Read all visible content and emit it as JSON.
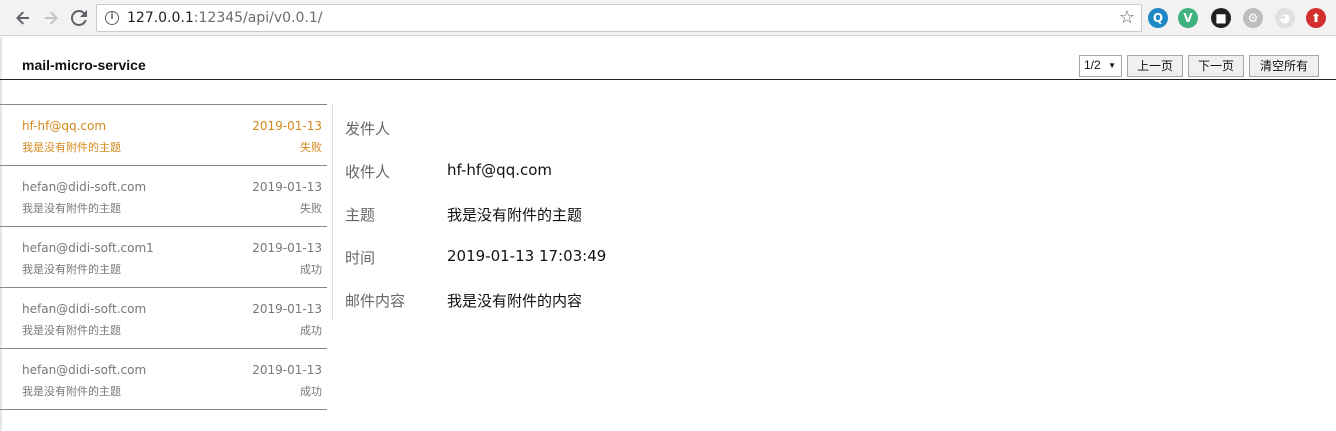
{
  "browser": {
    "url_host": "127.0.0.1",
    "url_rest": ":12345/api/v0.0.1/",
    "icons": [
      "back-icon",
      "forward-icon",
      "reload-icon",
      "info-icon",
      "star-icon"
    ],
    "extensions": [
      {
        "name": "extension-q-icon",
        "glyph": "Q",
        "color": "#1e88c7"
      },
      {
        "name": "extension-vue-icon",
        "glyph": "V",
        "color": "#3fb27f"
      },
      {
        "name": "extension-tampermonkey-icon",
        "glyph": "■",
        "color": "#222222"
      },
      {
        "name": "extension-gear-icon",
        "glyph": "⚙",
        "color": "#bdbdbd"
      },
      {
        "name": "extension-cat-icon",
        "glyph": "◕",
        "color": "#e0e0e0"
      },
      {
        "name": "extension-upload-icon",
        "glyph": "⬆",
        "color": "#d32f2f"
      }
    ]
  },
  "header": {
    "title": "mail-micro-service",
    "pager_value": "1/2",
    "prev_label": "上一页",
    "next_label": "下一页",
    "clear_label": "清空所有"
  },
  "mails": [
    {
      "sender": "hf-hf@qq.com",
      "date": "2019-01-13",
      "subject": "我是没有附件的主题",
      "status": "失败"
    },
    {
      "sender": "hefan@didi-soft.com",
      "date": "2019-01-13",
      "subject": "我是没有附件的主题",
      "status": "失败"
    },
    {
      "sender": "hefan@didi-soft.com1",
      "date": "2019-01-13",
      "subject": "我是没有附件的主题",
      "status": "成功"
    },
    {
      "sender": "hefan@didi-soft.com",
      "date": "2019-01-13",
      "subject": "我是没有附件的主题",
      "status": "成功"
    },
    {
      "sender": "hefan@didi-soft.com",
      "date": "2019-01-13",
      "subject": "我是没有附件的主题",
      "status": "成功"
    }
  ],
  "detail": {
    "from_label": "发件人",
    "from_value": "",
    "to_label": "收件人",
    "to_value": "hf-hf@qq.com",
    "subject_label": "主题",
    "subject_value": "我是没有附件的主题",
    "time_label": "时间",
    "time_value": "2019-01-13 17:03:49",
    "content_label": "邮件内容",
    "content_value": "我是没有附件的内容"
  },
  "colors": {
    "active_item": "#d4891c",
    "muted_text": "#777777"
  }
}
